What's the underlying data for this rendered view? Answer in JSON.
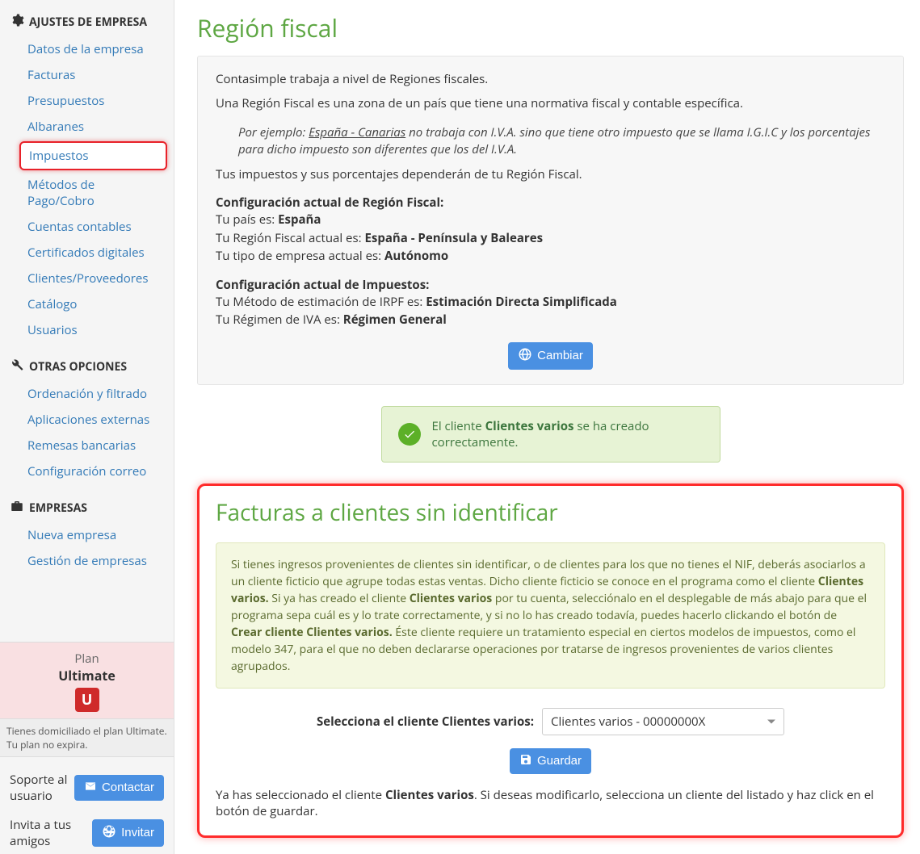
{
  "sidebar": {
    "sections": [
      {
        "title": "AJUSTES DE EMPRESA",
        "icon": "gear",
        "items": [
          "Datos de la empresa",
          "Facturas",
          "Presupuestos",
          "Albaranes",
          "Impuestos",
          "Métodos de Pago/Cobro",
          "Cuentas contables",
          "Certificados digitales",
          "Clientes/Proveedores",
          "Catálogo",
          "Usuarios"
        ],
        "highlighted_index": 4
      },
      {
        "title": "OTRAS OPCIONES",
        "icon": "wrench",
        "items": [
          "Ordenación y filtrado",
          "Aplicaciones externas",
          "Remesas bancarias",
          "Configuración correo"
        ]
      },
      {
        "title": "EMPRESAS",
        "icon": "briefcase",
        "items": [
          "Nueva empresa",
          "Gestión de empresas"
        ]
      }
    ],
    "plan": {
      "line1": "Plan",
      "line2": "Ultimate",
      "badge": "U",
      "note": "Tienes domiciliado el plan Ultimate. Tu plan no expira."
    },
    "support": {
      "label": "Soporte al usuario",
      "button": "Contactar"
    },
    "invite": {
      "label": "Invita a tus amigos",
      "button": "Invitar"
    }
  },
  "main": {
    "title": "Región fiscal",
    "intro_p1": "Contasimple trabaja a nivel de Regiones fiscales.",
    "intro_p2": "Una Región Fiscal es una zona de un país que tiene una normativa fiscal y contable específica.",
    "example_prefix": "Por ejemplo: ",
    "example_link": "España - Canarias",
    "example_rest": " no trabaja con I.V.A. sino que tiene otro impuesto que se llama I.G.I.C y los porcentajes para dicho impuesto son diferentes que los del I.V.A.",
    "intro_p3": "Tus impuestos y sus porcentajes dependerán de tu Región Fiscal.",
    "cfg_region_head": "Configuración actual de Región Fiscal:",
    "cfg_country_label": "Tu país es: ",
    "cfg_country_value": "España",
    "cfg_region_label": "Tu Región Fiscal actual es: ",
    "cfg_region_value": "España - Península y Baleares",
    "cfg_type_label": "Tu tipo de empresa actual es: ",
    "cfg_type_value": "Autónomo",
    "cfg_tax_head": "Configuración actual de Impuestos:",
    "cfg_irpf_label": "Tu Método de estimación de IRPF es: ",
    "cfg_irpf_value": "Estimación Directa Simplificada",
    "cfg_iva_label": "Tu Régimen de IVA es: ",
    "cfg_iva_value": "Régimen General",
    "change_button": "Cambiar",
    "alert_prefix": "El cliente ",
    "alert_bold": "Clientes varios",
    "alert_suffix": " se ha creado correctamente.",
    "section2_title": "Facturas a clientes sin identificar",
    "info_t1": "Si tienes ingresos provenientes de clientes sin identificar, o de clientes para los que no tienes el NIF, deberás asociarlos a un cliente ficticio que agrupe todas estas ventas. Dicho cliente ficticio se conoce en el programa como el cliente ",
    "info_b1": "Clientes varios.",
    "info_t2": " Si ya has creado el cliente ",
    "info_b2": "Clientes varios",
    "info_t3": " por tu cuenta, selecciónalo en el desplegable de más abajo para que el programa sepa cuál es y lo trate correctamente, y si no lo has creado todavía, puedes hacerlo clickando el botón de ",
    "info_b3": "Crear cliente Clientes varios.",
    "info_t4": " Éste cliente requiere un tratamiento especial en ciertos modelos de impuestos, como el modelo 347, para el que no deben declararse operaciones por tratarse de ingresos provenientes de varios clientes agrupados.",
    "select_label": "Selecciona el cliente Clientes varios:",
    "select_value": "Clientes varios - 00000000X",
    "save_button": "Guardar",
    "note_t1": "Ya has seleccionado el cliente ",
    "note_b1": "Clientes varios",
    "note_t2": ". Si deseas modificarlo, selecciona un cliente del listado y haz click en el botón de guardar."
  }
}
